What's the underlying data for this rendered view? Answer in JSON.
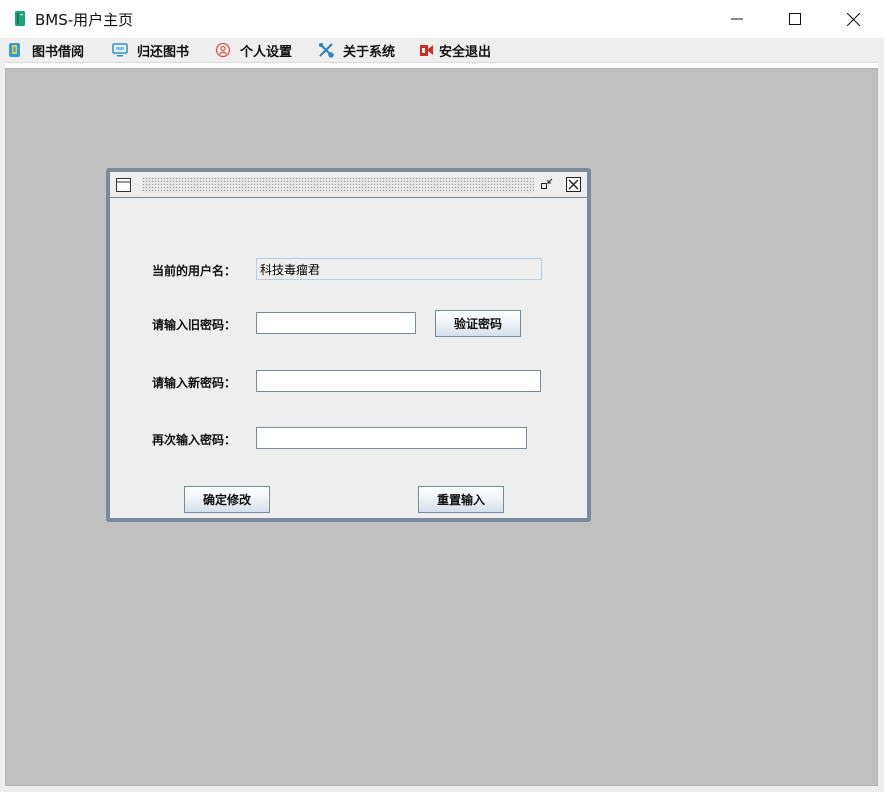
{
  "window": {
    "title": "BMS-用户主页",
    "colors": {
      "app_icon": "#1aa37a",
      "desktop": "#c0c0c0",
      "frame_border": "#7a8a99"
    }
  },
  "menubar": {
    "items": [
      {
        "label": "图书借阅",
        "icon": "book-borrow-icon"
      },
      {
        "label": "归还图书",
        "icon": "monitor-icon"
      },
      {
        "label": "个人设置",
        "icon": "user-settings-icon"
      },
      {
        "label": "关于系统",
        "icon": "tools-icon"
      },
      {
        "label": "安全退出",
        "icon": "exit-icon"
      }
    ]
  },
  "dialog": {
    "current_user_label": "当前的用户名：",
    "current_user_value": "科技毒瘤君",
    "old_password_label": "请输入旧密码：",
    "old_password_value": "",
    "verify_button": "验证密码",
    "new_password_label": "请输入新密码：",
    "new_password_value": "",
    "confirm_password_label": "再次输入密码：",
    "confirm_password_value": "",
    "confirm_button": "确定修改",
    "reset_button": "重置输入"
  }
}
